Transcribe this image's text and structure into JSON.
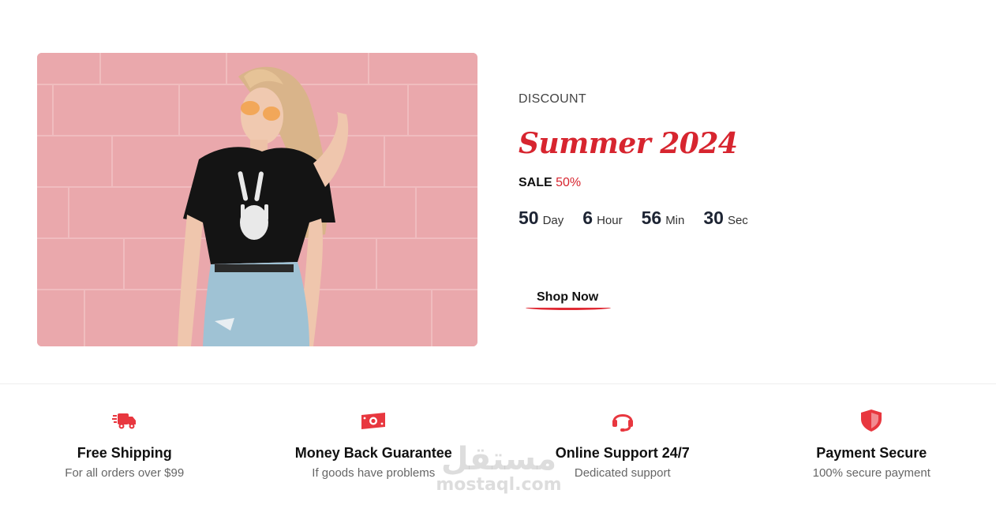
{
  "promo": {
    "eyebrow": "DISCOUNT",
    "title": "Summer 2024",
    "sale_label": "SALE",
    "sale_percent": "50%",
    "countdown": [
      {
        "value": "50",
        "unit": "Day"
      },
      {
        "value": "6",
        "unit": "Hour"
      },
      {
        "value": "56",
        "unit": "Min"
      },
      {
        "value": "30",
        "unit": "Sec"
      }
    ],
    "cta_label": "Shop Now"
  },
  "features": [
    {
      "icon": "truck-icon",
      "title": "Free Shipping",
      "desc": "For all orders over $99"
    },
    {
      "icon": "money-icon",
      "title": "Money Back Guarantee",
      "desc": "If goods have problems"
    },
    {
      "icon": "headset-icon",
      "title": "Online Support 24/7",
      "desc": "Dedicated support"
    },
    {
      "icon": "shield-icon",
      "title": "Payment Secure",
      "desc": "100% secure payment"
    }
  ],
  "watermark": {
    "arabic": "مستقل",
    "latin": "mostaql.com"
  },
  "colors": {
    "accent": "#d7252f",
    "hero_bg": "#eba9ad",
    "text": "#111111",
    "muted": "#666666"
  }
}
